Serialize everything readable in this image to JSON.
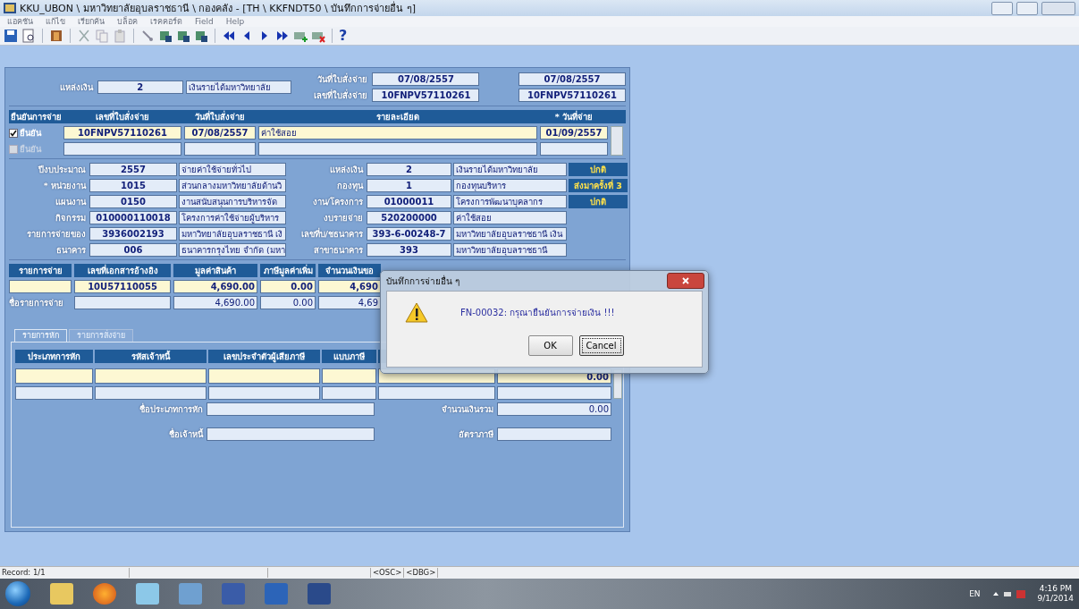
{
  "window": {
    "title": "KKU_UBON \\ มหาวิทยาลัยอุบลราชธานี \\ กองคลัง - [TH \\ KKFNDT50 \\ บันทึกการจ่ายอื่น ๆ]"
  },
  "menu": [
    "แอคชัน",
    "แก้ไข",
    "เรียกค้น",
    "บล็อค",
    "เรคคอร์ด",
    "Field",
    "Help"
  ],
  "toolbar": {
    "help_glyph": "?"
  },
  "header": {
    "source_label": "แหล่งเงิน",
    "source_code": "2",
    "source_name": "เงินรายได้มหาวิทยาลัย",
    "date_label": "วันที่ใบสั่งจ่าย",
    "number_label": "เลขที่ใบสั่งจ่าย",
    "date": "07/08/2557",
    "number": "10FNPV57110261",
    "date_2": "07/08/2557",
    "number_2": "10FNPV57110261"
  },
  "orders": {
    "columns": [
      "ยืนยันการจ่าย",
      "เลขที่ใบสั่งจ่าย",
      "วันที่ใบสั่งจ่าย",
      "รายละเอียด",
      "* วันที่จ่าย"
    ],
    "rows": [
      {
        "confirm_label": "ยืนยัน",
        "checked": true,
        "disabled": false,
        "number": "10FNPV57110261",
        "date": "07/08/2557",
        "detail": "ค่าใช้สอย",
        "pay_date": "01/09/2557"
      },
      {
        "confirm_label": "ยืนยัน",
        "checked": false,
        "disabled": true
      }
    ]
  },
  "details": [
    {
      "label": "ปีงบประมาณ",
      "code": "2557",
      "name": "จ่ายค่าใช้จ่ายทั่วไป",
      "label_2": "แหล่งเงิน",
      "code_2": "2",
      "name_2": "เงินรายได้มหาวิทยาลัย",
      "status": "ปกติ"
    },
    {
      "label": "* หน่วยงาน",
      "code": "1015",
      "name": "ส่วนกลางมหาวิทยาลัยด้านวิ",
      "label_2": "กองทุน",
      "code_2": "1",
      "name_2": "กองทุนบริหาร",
      "status": "ส่งมาครั้งที่ 3"
    },
    {
      "label": "แผนงาน",
      "code": "0150",
      "name": "งานสนับสนุนการบริหารจัด",
      "label_2": "งาน/โครงการ",
      "code_2": "01000011",
      "name_2": "โครงการพัฒนาบุคลากร",
      "status": "ปกติ"
    },
    {
      "label": "กิจกรรม",
      "code": "010000110018",
      "name": "โครงการค่าใช้จ่ายผู้บริหาร",
      "label_2": "งบรายจ่าย",
      "code_2": "520200000",
      "name_2": "ค่าใช้สอย"
    },
    {
      "label": "รายการจ่ายของ",
      "code": "3936002193",
      "name": "มหาวิทยาลัยอุบลราชธานี เงิ",
      "label_2": "เลขที่บ/ชธนาคาร",
      "code_2": "393-6-00248-7",
      "name_2": "มหาวิทยาลัยอุบลราชธานี เงิน"
    },
    {
      "label": "ธนาคาร",
      "code": "006",
      "name": "ธนาคารกรุงไทย จำกัด (มหา",
      "label_2": "สาขาธนาคาร",
      "code_2": "393",
      "name_2": "มหาวิทยาลัยอุบลราชธานี"
    }
  ],
  "payments": {
    "columns": [
      "รายการจ่าย",
      "เลขที่เอกสารอ้างอิง",
      "มูลค่าสินค้า",
      "ภาษีมูลค่าเพิ่ม",
      "จำนวนเงินขอ"
    ],
    "rows": [
      {
        "kind": "entry",
        "reference": "10U57110055",
        "value": "4,690.00",
        "vat": "0.00",
        "amount": "4,690"
      },
      {
        "kind": "total",
        "label": "ชื่อรายการจ่าย",
        "value": "4,690.00",
        "vat": "0.00",
        "amount": "4,69"
      }
    ]
  },
  "tabs": [
    {
      "label": "รายการหัก",
      "selected": true
    },
    {
      "label": "รายการสั่งจ่าย",
      "selected": false
    }
  ],
  "deductions": {
    "columns": [
      "ประเภทการหัก",
      "รหัสเจ้าหนี้",
      "เลขประจำตัวผู้เสียภาษี",
      "แบบภาษี"
    ],
    "first_row_amount": "0.00",
    "fields": [
      {
        "label": "ชื่อประเภทการหัก"
      },
      {
        "label": "ชื่อเจ้าหนี้"
      }
    ],
    "right_fields": [
      {
        "label": "จำนวนเงินรวม",
        "value": "0.00"
      },
      {
        "label": "อัตราภาษี"
      }
    ]
  },
  "dialog": {
    "title": "บันทึกการจ่ายอื่น ๆ",
    "message": "FN-00032: กรุณายืนยันการจ่ายเงิน !!!",
    "buttons": [
      {
        "label": "OK",
        "selected": false
      },
      {
        "label": "Cancel",
        "selected": true
      }
    ]
  },
  "status_bar": {
    "record": "Record: 1/1",
    "flags": [
      "<OSC>",
      "<DBG>"
    ]
  },
  "taskbar": {
    "language": "EN",
    "time": "4:16 PM",
    "date": "9/1/2014"
  }
}
